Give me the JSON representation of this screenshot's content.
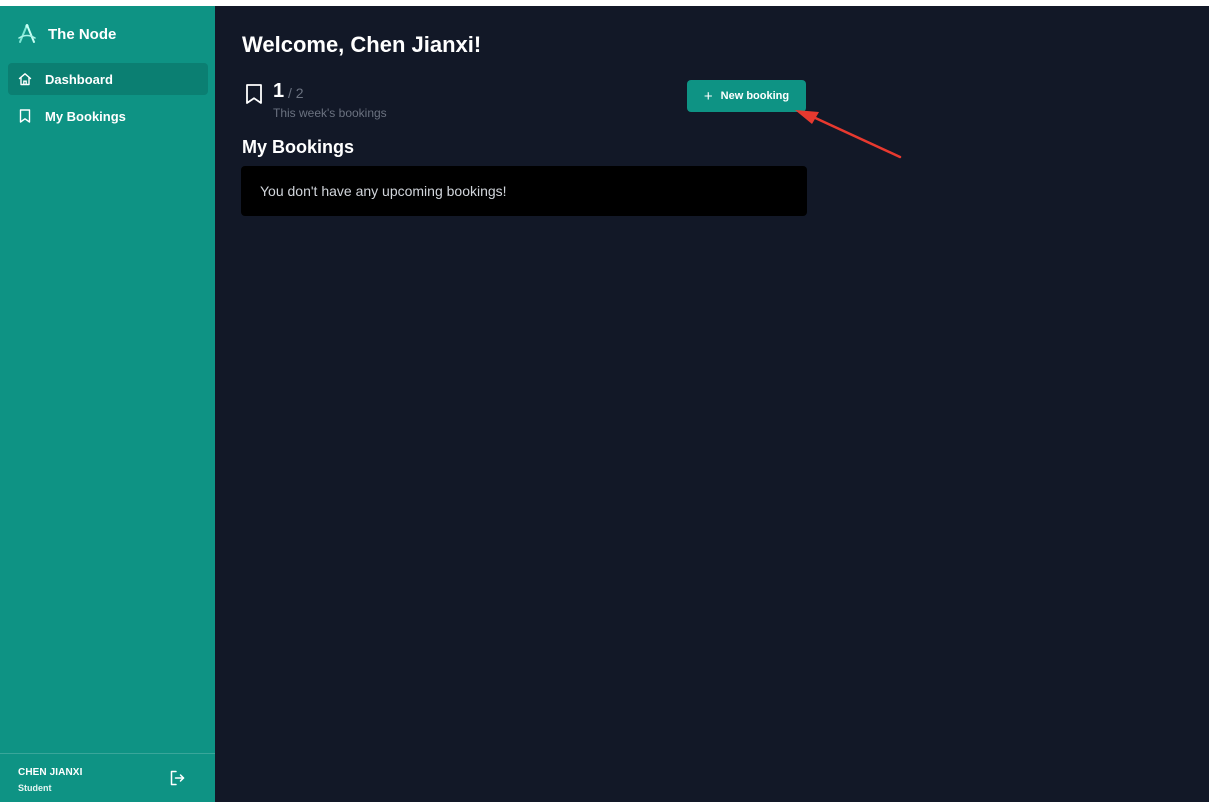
{
  "app": {
    "name": "The Node",
    "accent_color": "#0e9384",
    "background_color": "#121827"
  },
  "sidebar": {
    "items": [
      {
        "label": "Dashboard",
        "icon": "home-icon",
        "active": true
      },
      {
        "label": "My Bookings",
        "icon": "bookmark-icon",
        "active": false
      }
    ],
    "user": {
      "name": "CHEN JIANXI",
      "role": "Student"
    },
    "logout_icon": "logout-icon"
  },
  "main": {
    "welcome": "Welcome, Chen Jianxi!",
    "stats": {
      "count": "1",
      "total": "/ 2",
      "label": "This week's bookings",
      "icon": "bookmark-icon"
    },
    "new_booking_label": "New booking",
    "new_booking_icon": "plus-icon",
    "section_title": "My Bookings",
    "empty_message": "You don't have any upcoming bookings!"
  },
  "annotation": {
    "type": "arrow",
    "color": "#e8392f"
  }
}
